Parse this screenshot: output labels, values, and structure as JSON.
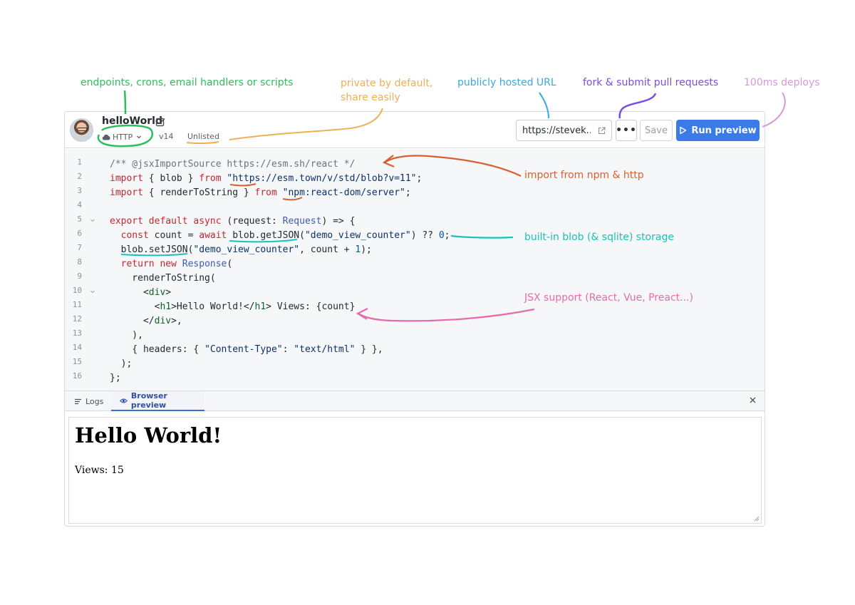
{
  "annotations": {
    "triggers": "endpoints, crons, email handlers or scripts",
    "private_line1": "private by default,",
    "private_line2": "share easily",
    "hosted_url": "publicly hosted URL",
    "fork": "fork & submit pull requests",
    "deploys": "100ms deploys",
    "imports": "import from npm & http",
    "storage": "built-in blob (& sqlite) storage",
    "jsx": "JSX support (React, Vue, Preact...)"
  },
  "header": {
    "val_name": "helloWorld",
    "type_label": "HTTP",
    "version": "v14",
    "privacy": "Unlisted",
    "url": "https://stevek...",
    "save_label": "Save",
    "run_label": "Run preview",
    "more_label": "•••"
  },
  "editor": {
    "line_numbers": [
      "1",
      "2",
      "3",
      "4",
      "5",
      "6",
      "7",
      "8",
      "9",
      "10",
      "11",
      "12",
      "13",
      "14",
      "15",
      "16"
    ]
  },
  "panel": {
    "tab_logs": "Logs",
    "tab_preview": "Browser preview",
    "preview_heading": "Hello World!",
    "preview_text": "Views: 15"
  },
  "colors": {
    "run_button": "#3b7be8",
    "annotation_green": "#2ebd5d",
    "annotation_orange": "#eeb056",
    "annotation_blue": "#3aa7e6",
    "annotation_purple": "#7a4ce0",
    "annotation_pink": "#d59ad8",
    "annotation_red": "#d4612f",
    "annotation_teal": "#18c2b8",
    "annotation_magenta": "#e66ca9"
  },
  "icons": [
    "edit-icon",
    "cloud-icon",
    "chevron-down-icon",
    "external-link-icon",
    "more-icon",
    "play-icon",
    "logs-icon",
    "eye-icon",
    "close-icon",
    "resize-handle-icon",
    "fold-chevron-icon"
  ]
}
